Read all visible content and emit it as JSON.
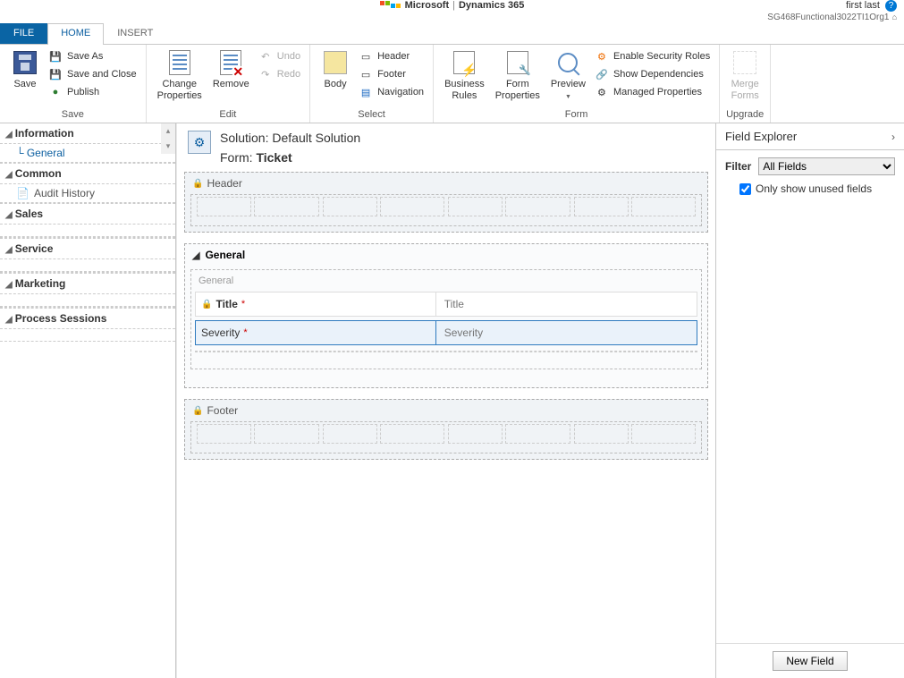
{
  "brand": {
    "company": "Microsoft",
    "product": "Dynamics 365",
    "user": "first last",
    "org": "SG468Functional3022TI1Org1"
  },
  "tabs": {
    "file": "FILE",
    "home": "HOME",
    "insert": "INSERT"
  },
  "ribbon": {
    "save_group": "Save",
    "save": "Save",
    "save_as": "Save As",
    "save_close": "Save and Close",
    "publish": "Publish",
    "edit_group": "Edit",
    "change_props": "Change\nProperties",
    "remove": "Remove",
    "undo": "Undo",
    "redo": "Redo",
    "select_group": "Select",
    "body": "Body",
    "header": "Header",
    "footer": "Footer",
    "navigation": "Navigation",
    "form_group": "Form",
    "biz_rules": "Business\nRules",
    "form_props": "Form\nProperties",
    "preview": "Preview",
    "enable_sec": "Enable Security Roles",
    "show_deps": "Show Dependencies",
    "managed_props": "Managed Properties",
    "upgrade_group": "Upgrade",
    "merge_forms": "Merge\nForms"
  },
  "left": {
    "information": "Information",
    "general_link": "General",
    "common": "Common",
    "audit_history": "Audit History",
    "sales": "Sales",
    "service": "Service",
    "marketing": "Marketing",
    "process_sessions": "Process Sessions"
  },
  "canvas": {
    "solution_label": "Solution:",
    "solution_name": "Default Solution",
    "form_label": "Form:",
    "form_name": "Ticket",
    "header": "Header",
    "footer": "Footer",
    "general": "General",
    "general_sub": "General",
    "fields": {
      "title": {
        "label": "Title",
        "placeholder": "Title",
        "required": true,
        "locked": true
      },
      "severity": {
        "label": "Severity",
        "placeholder": "Severity",
        "required": true,
        "locked": false
      }
    }
  },
  "right": {
    "title": "Field Explorer",
    "filter_label": "Filter",
    "filter_value": "All Fields",
    "unused_label": "Only show unused fields",
    "unused_checked": true,
    "new_field": "New Field"
  }
}
